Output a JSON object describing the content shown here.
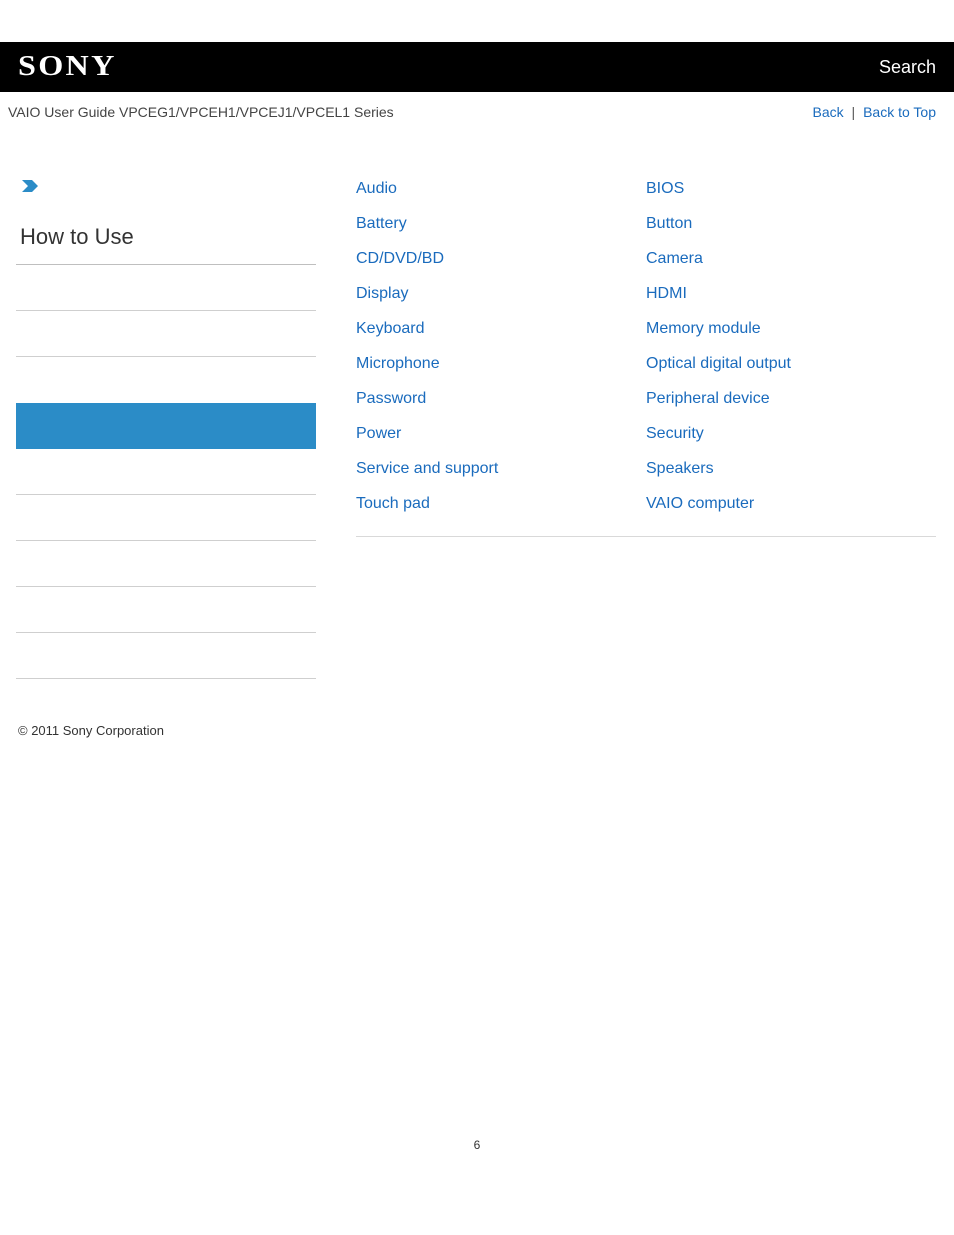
{
  "header": {
    "logo_text": "SONY",
    "search_label": "Search"
  },
  "subheader": {
    "guide_title": "VAIO User Guide VPCEG1/VPCEH1/VPCEJ1/VPCEL1 Series",
    "back_label": "Back",
    "separator": " | ",
    "back_to_top_label": "Back to Top"
  },
  "sidebar": {
    "title": "How to Use"
  },
  "topics": {
    "col1": [
      "Audio",
      "Battery",
      "CD/DVD/BD",
      "Display",
      "Keyboard",
      "Microphone",
      "Password",
      "Power",
      "Service and support",
      "Touch pad"
    ],
    "col2": [
      "BIOS",
      "Button",
      "Camera",
      "HDMI",
      "Memory module",
      "Optical digital output",
      "Peripheral device",
      "Security",
      "Speakers",
      "VAIO computer"
    ]
  },
  "footer": {
    "copyright": "© 2011 Sony Corporation"
  },
  "page_number": "6"
}
